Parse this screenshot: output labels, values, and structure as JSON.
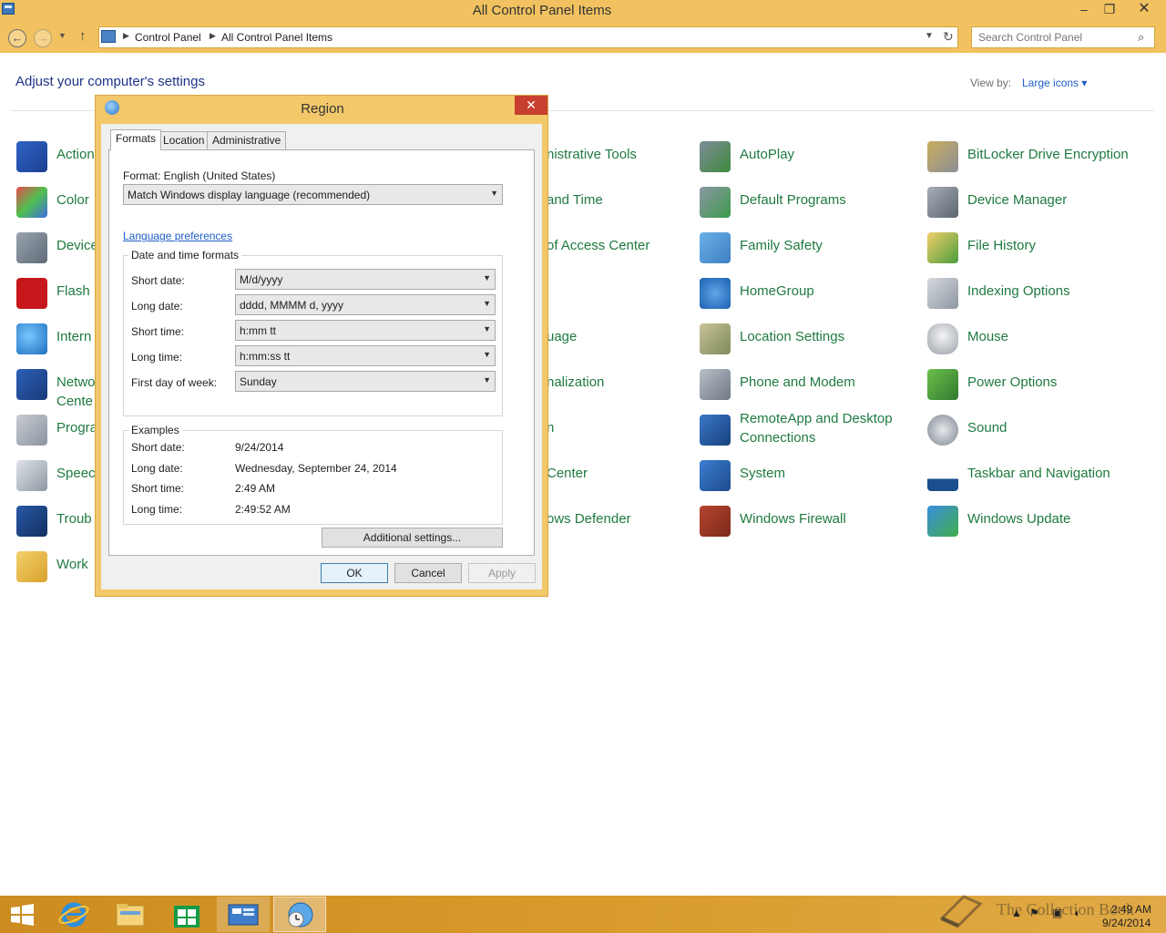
{
  "window": {
    "title": "All Control Panel Items",
    "minimize_glyph": "–",
    "maximize_glyph": "❐",
    "close_glyph": "✕"
  },
  "addressbar": {
    "breadcrumb": [
      "Control Panel",
      "All Control Panel Items"
    ],
    "search_placeholder": "Search Control Panel"
  },
  "content": {
    "heading": "Adjust your computer's settings",
    "view_by_label": "View by:",
    "view_by_value": "Large icons ▾"
  },
  "items": {
    "col1": [
      "Action",
      "Color",
      "Device",
      "Flash",
      "Intern",
      "Netwo",
      "Progra",
      "Speec",
      "Troub",
      "Work"
    ],
    "col1_network_line2": "Cente",
    "col2": [
      "nistrative Tools",
      "and Time",
      "of Access Center",
      "uage",
      "nalization",
      "n",
      "Center",
      "ows Defender"
    ],
    "col3": [
      "AutoPlay",
      "Default Programs",
      "Family Safety",
      "HomeGroup",
      "Location Settings",
      "Phone and Modem",
      "RemoteApp and Desktop",
      "System",
      "Windows Firewall"
    ],
    "col3_remoteapp_line2": "Connections",
    "col4": [
      "BitLocker Drive Encryption",
      "Device Manager",
      "File History",
      "Indexing Options",
      "Mouse",
      "Power Options",
      "Sound",
      "Taskbar and Navigation",
      "Windows Update"
    ]
  },
  "dialog": {
    "title": "Region",
    "close_glyph": "✕",
    "tabs": [
      "Formats",
      "Location",
      "Administrative"
    ],
    "format_label": "Format: English (United States)",
    "format_value": "Match Windows display language (recommended)",
    "language_link": "Language preferences",
    "date_time_group": "Date and time formats",
    "fields": [
      {
        "label": "Short date:",
        "value": "M/d/yyyy"
      },
      {
        "label": "Long date:",
        "value": "dddd, MMMM d, yyyy"
      },
      {
        "label": "Short time:",
        "value": "h:mm tt"
      },
      {
        "label": "Long time:",
        "value": "h:mm:ss tt"
      },
      {
        "label": "First day of week:",
        "value": "Sunday"
      }
    ],
    "examples_group": "Examples",
    "examples": [
      {
        "label": "Short date:",
        "value": "9/24/2014"
      },
      {
        "label": "Long date:",
        "value": "Wednesday, September 24, 2014"
      },
      {
        "label": "Short time:",
        "value": "2:49 AM"
      },
      {
        "label": "Long time:",
        "value": "2:49:52 AM"
      }
    ],
    "additional_settings": "Additional settings...",
    "ok": "OK",
    "cancel": "Cancel",
    "apply": "Apply"
  },
  "taskbar": {
    "clock_time": "2:49 AM",
    "clock_date": "9/24/2014",
    "watermark": "The Collection Book"
  }
}
